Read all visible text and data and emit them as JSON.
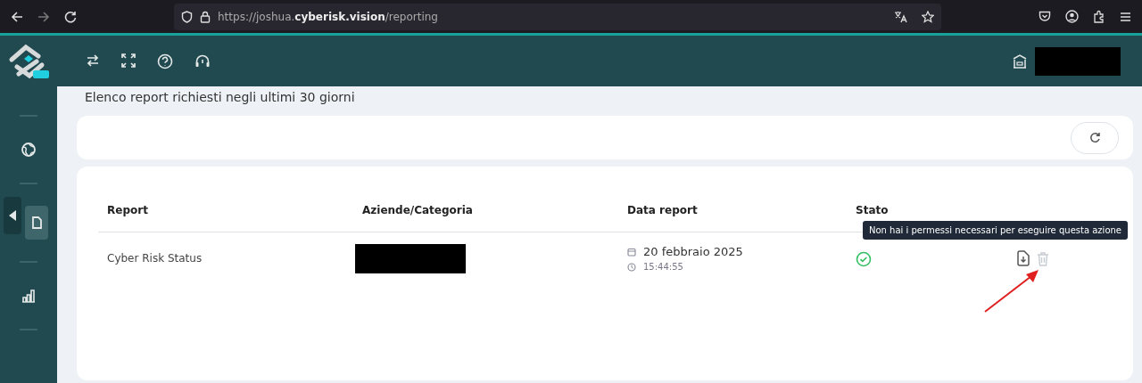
{
  "browser": {
    "url_prefix": "https://joshua.",
    "url_host": "cyberisk.vision",
    "url_path": "/reporting"
  },
  "sidebar": {
    "items": [
      {
        "selected": false
      },
      {
        "selected": true
      },
      {
        "selected": false
      }
    ]
  },
  "page_title": "Elenco report richiesti negli ultimi 30 giorni",
  "table": {
    "columns": [
      "Report",
      "Aziende/Categoria",
      "Data report",
      "Stato"
    ],
    "rows": [
      {
        "report": "Cyber Risk Status",
        "date": "20 febbraio 2025",
        "time": "15:44:55",
        "success": true,
        "delete_disabled": true
      }
    ]
  },
  "tooltip": "Non hai i permessi necessari per eseguire questa azione"
}
